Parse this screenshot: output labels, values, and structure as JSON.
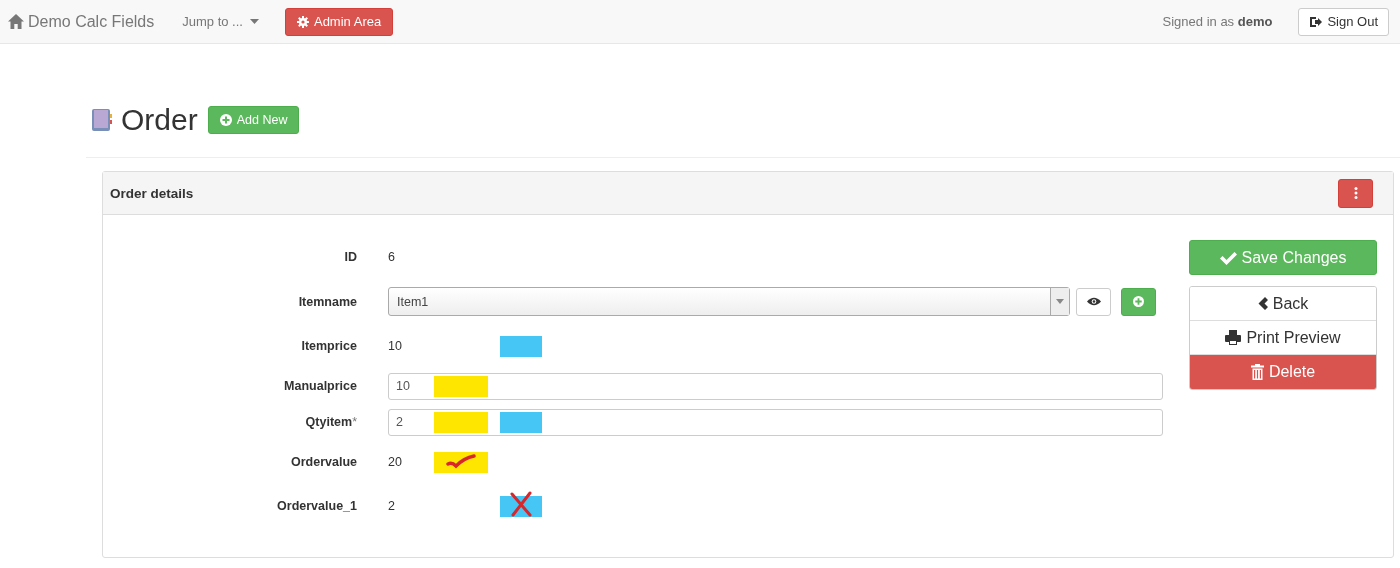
{
  "navbar": {
    "brand": "Demo Calc Fields",
    "jump": "Jump to ...",
    "admin": "Admin Area",
    "signed_in_prefix": "Signed in as",
    "user": "demo",
    "sign_out": "Sign Out"
  },
  "page": {
    "title": "Order",
    "add_new": "Add New"
  },
  "panel": {
    "title": "Order details",
    "fields": [
      {
        "label": "ID",
        "kind": "text",
        "value": "6"
      },
      {
        "label": "Itemname",
        "kind": "select",
        "value": "Item1"
      },
      {
        "label": "Itemprice",
        "kind": "text",
        "value": "10",
        "marks": [
          {
            "color": "#45c6f4",
            "kind": "plain"
          }
        ]
      },
      {
        "label": "Manualprice",
        "kind": "input",
        "value": "10",
        "marks": [
          {
            "color": "#ffe600",
            "kind": "plain"
          }
        ]
      },
      {
        "label": "Qtyitem",
        "required": "*",
        "kind": "input",
        "value": "2",
        "marks": [
          {
            "color": "#ffe600",
            "kind": "plain"
          },
          {
            "color": "#45c6f4",
            "kind": "plain"
          }
        ]
      },
      {
        "label": "Ordervalue",
        "kind": "text",
        "value": "20",
        "marks": [
          {
            "color": "#ffe600",
            "kind": "check"
          }
        ]
      },
      {
        "label": "Ordervalue_1",
        "kind": "text",
        "value": "2",
        "marks": [
          {
            "color": "#45c6f4",
            "kind": "cross"
          }
        ]
      }
    ],
    "actions": {
      "save": "Save Changes",
      "back": "Back",
      "print": "Print Preview",
      "delete": "Delete"
    }
  }
}
